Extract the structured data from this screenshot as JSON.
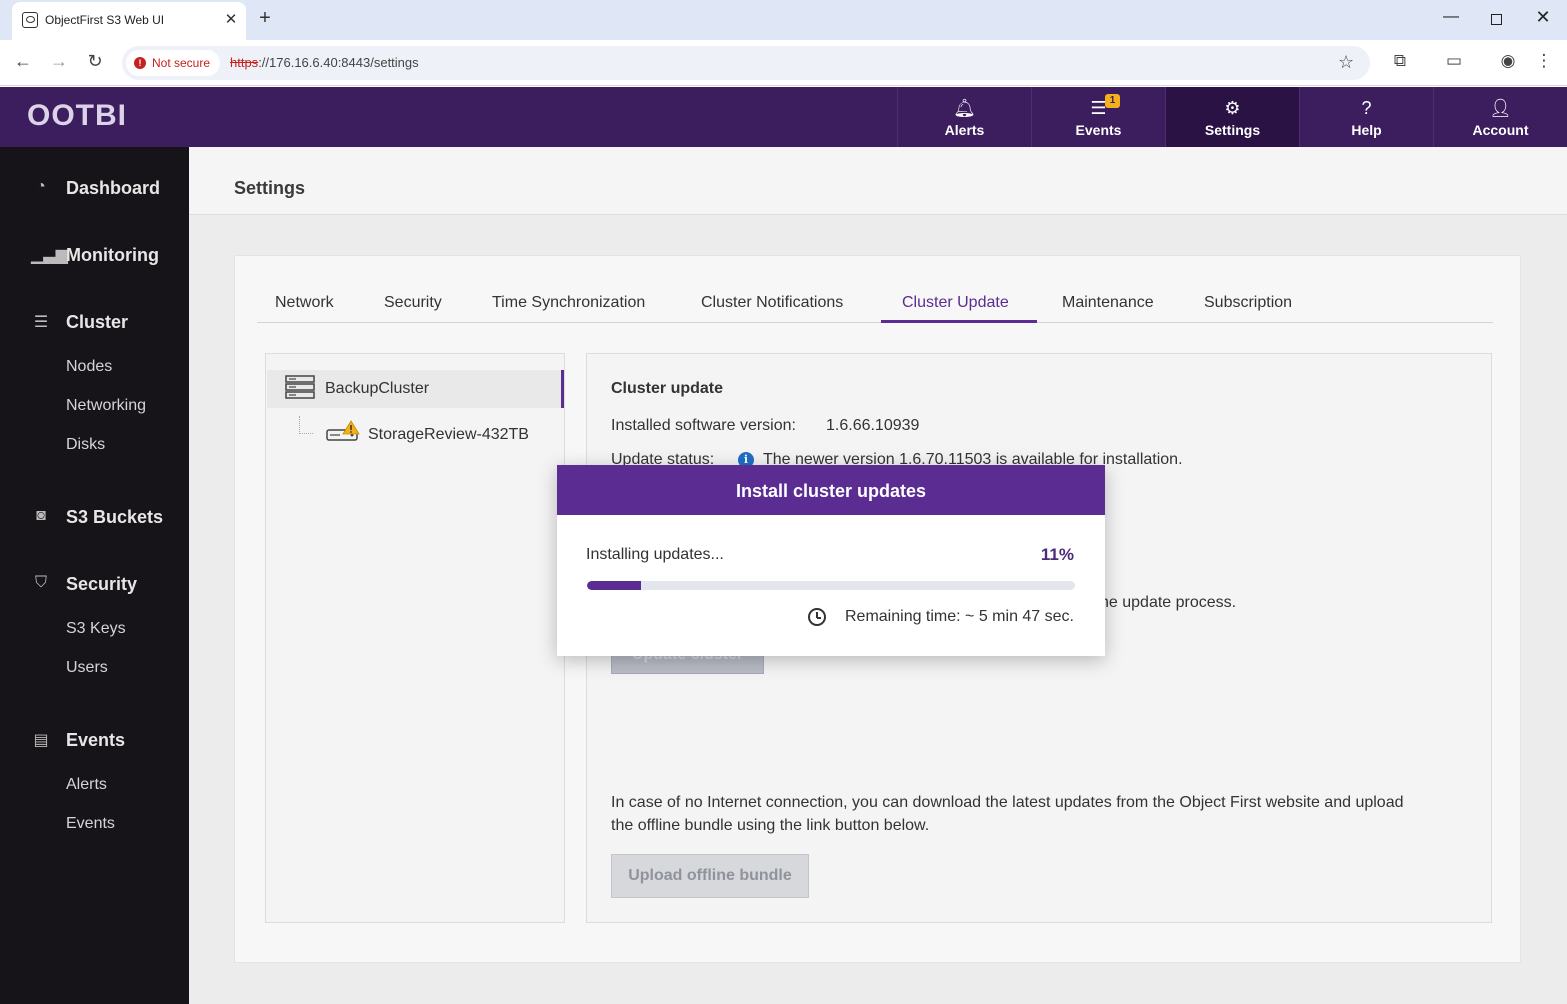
{
  "browser": {
    "tab_title": "ObjectFirst S3 Web UI",
    "security_label": "Not secure",
    "url_scheme": "https",
    "url_rest": "://176.16.6.40:8443/settings"
  },
  "app": {
    "logo": "OOTBI",
    "header_nav": [
      {
        "label": "Alerts",
        "icon": "bell-icon"
      },
      {
        "label": "Events",
        "icon": "list-icon",
        "badge": "1"
      },
      {
        "label": "Settings",
        "icon": "gear-icon",
        "active": true
      },
      {
        "label": "Help",
        "icon": "question-icon"
      },
      {
        "label": "Account",
        "icon": "user-icon"
      }
    ]
  },
  "sidebar": {
    "dashboard": "Dashboard",
    "monitoring": "Monitoring",
    "cluster": "Cluster",
    "cluster_items": [
      "Nodes",
      "Networking",
      "Disks"
    ],
    "s3_buckets": "S3 Buckets",
    "security": "Security",
    "security_items": [
      "S3 Keys",
      "Users"
    ],
    "events": "Events",
    "events_items": [
      "Alerts",
      "Events"
    ]
  },
  "page": {
    "title": "Settings",
    "tabs": [
      "Network",
      "Security",
      "Time Synchronization",
      "Cluster Notifications",
      "Cluster Update",
      "Maintenance",
      "Subscription"
    ],
    "active_tab": "Cluster Update"
  },
  "tree": {
    "root": "BackupCluster",
    "child": "StorageReview-432TB"
  },
  "detail": {
    "section_title": "Cluster update",
    "installed_label": "Installed software version:",
    "installed_value": "1.6.66.10939",
    "status_label": "Update status:",
    "status_text": "The newer version 1.6.70.11503 is available for installation.",
    "process_note": "he update process.",
    "update_button": "Update cluster",
    "offline_text": "In case of no Internet connection, you can download the latest updates from the Object First website and upload the offline bundle using the link button below.",
    "upload_button": "Upload offline bundle"
  },
  "modal": {
    "title": "Install cluster updates",
    "progress_label": "Installing updates...",
    "progress_percent": 11,
    "progress_text": "11%",
    "remaining": "Remaining time: ~ 5 min 47 sec."
  },
  "colors": {
    "brand_purple": "#5b2c91",
    "header_bg": "#3c1d5e",
    "sidebar_bg": "#171419",
    "warning": "#f3b21b",
    "info": "#1f6fc5"
  }
}
